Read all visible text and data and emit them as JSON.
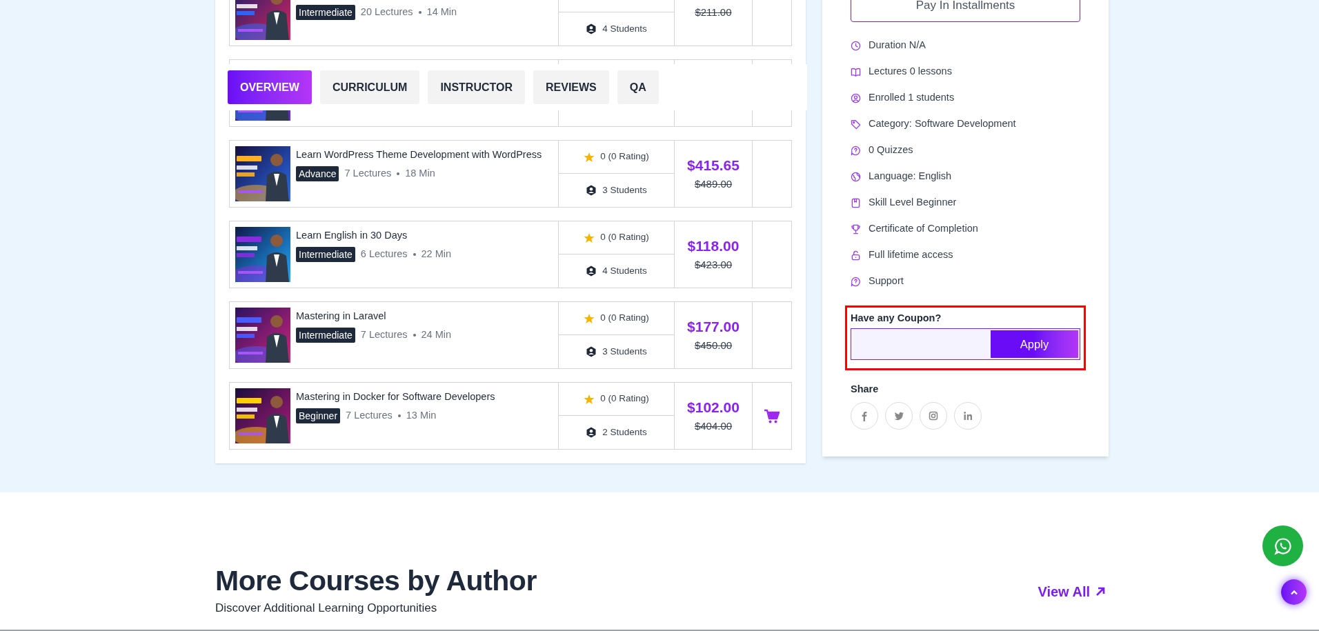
{
  "courses": [
    {
      "level": "Intermediate",
      "lectures": "20 Lectures",
      "duration": "14 Min",
      "students": "4 Students",
      "old_price": "$211.00",
      "show_cart": false
    },
    {
      "show_cart": false
    },
    {
      "title": "Learn WordPress Theme Development with WordPress",
      "level": "Advance",
      "lectures": "7 Lectures",
      "duration": "18 Min",
      "rating": "0 (0 Rating)",
      "students": "3 Students",
      "price": "$415.65",
      "old_price": "$489.00",
      "show_cart": false
    },
    {
      "title": "Learn English in 30 Days",
      "level": "Intermediate",
      "lectures": "6 Lectures",
      "duration": "22 Min",
      "rating": "0 (0 Rating)",
      "students": "4 Students",
      "price": "$118.00",
      "old_price": "$423.00",
      "show_cart": false
    },
    {
      "title": "Mastering in Laravel",
      "level": "Intermediate",
      "lectures": "7 Lectures",
      "duration": "24 Min",
      "rating": "0 (0 Rating)",
      "students": "3 Students",
      "price": "$177.00",
      "old_price": "$450.00",
      "show_cart": false
    },
    {
      "title": "Mastering in Docker for Software Developers",
      "level": "Beginner",
      "lectures": "7 Lectures",
      "duration": "13 Min",
      "rating": "0 (0 Rating)",
      "students": "2 Students",
      "price": "$102.00",
      "old_price": "$404.00",
      "show_cart": true
    }
  ],
  "tabs": [
    {
      "label": "OVERVIEW",
      "selected": true
    },
    {
      "label": "CURRICULUM",
      "selected": false
    },
    {
      "label": "INSTRUCTOR",
      "selected": false
    },
    {
      "label": "REVIEWS",
      "selected": false
    },
    {
      "label": "QA",
      "selected": false
    }
  ],
  "sidebar": {
    "pay_button": "Pay In Installments",
    "features": [
      {
        "kind": "duration",
        "text": "Duration N/A"
      },
      {
        "kind": "lectures",
        "text": "Lectures 0 lessons"
      },
      {
        "kind": "enrolled",
        "text": "Enrolled 1 students"
      },
      {
        "kind": "category",
        "text": "Category: Software Development"
      },
      {
        "kind": "quizzes",
        "text": "0 Quizzes"
      },
      {
        "kind": "language",
        "text": "Language: English"
      },
      {
        "kind": "level",
        "text": "Skill Level Beginner"
      },
      {
        "kind": "certificate",
        "text": "Certificate of Completion"
      },
      {
        "kind": "access",
        "text": "Full lifetime access"
      },
      {
        "kind": "support",
        "text": "Support"
      }
    ],
    "coupon": {
      "label": "Have any Coupon?",
      "button": "Apply"
    },
    "share": {
      "label": "Share"
    }
  },
  "more_courses": {
    "heading": "More Courses by Author",
    "subtitle": "Discover Additional Learning Opportunities",
    "view_all": "View All"
  }
}
